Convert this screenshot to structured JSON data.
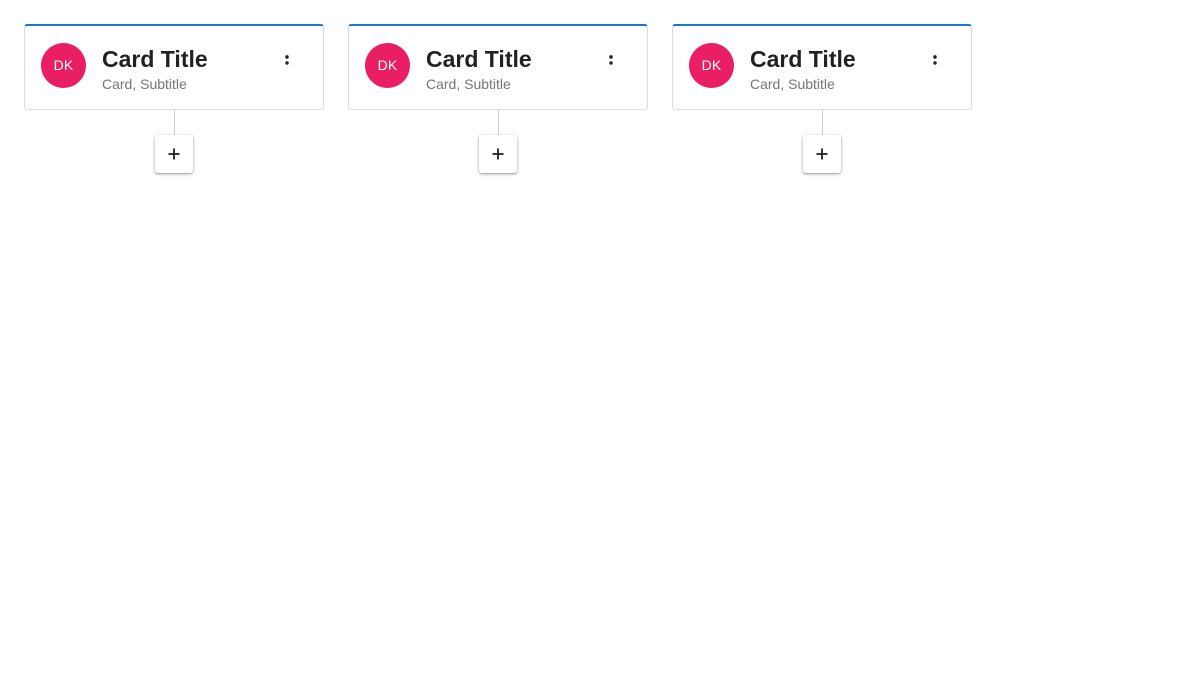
{
  "colors": {
    "card_accent": "#1976d2",
    "avatar_bg": "#e91e63",
    "title_text": "#212121",
    "subtitle_text": "#757575"
  },
  "cards": [
    {
      "avatar_initials": "DK",
      "title": "Card Title",
      "subtitle": "Card, Subtitle",
      "menu_icon": "more-vert-icon",
      "add_icon": "plus-icon"
    },
    {
      "avatar_initials": "DK",
      "title": "Card Title",
      "subtitle": "Card, Subtitle",
      "menu_icon": "more-vert-icon",
      "add_icon": "plus-icon"
    },
    {
      "avatar_initials": "DK",
      "title": "Card Title",
      "subtitle": "Card, Subtitle",
      "menu_icon": "more-vert-icon",
      "add_icon": "plus-icon"
    }
  ]
}
